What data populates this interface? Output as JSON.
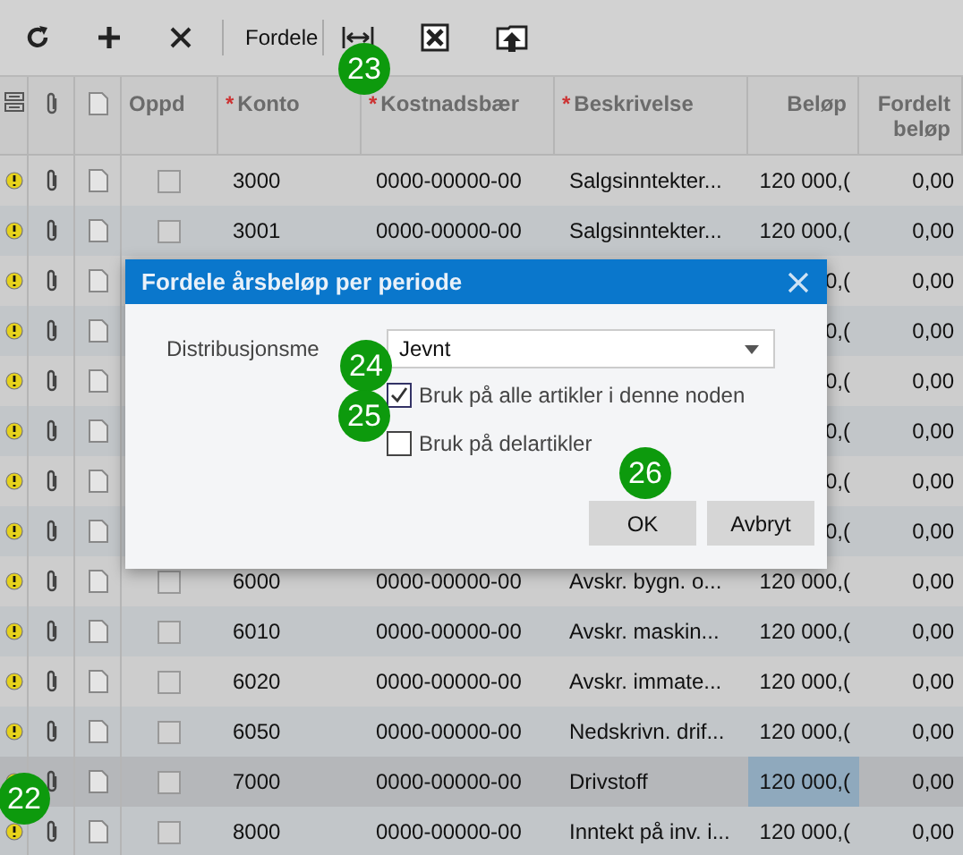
{
  "toolbar": {
    "distribute_button": "Fordele"
  },
  "table": {
    "columns": [
      {
        "label": "Oppd"
      },
      {
        "label": "Konto",
        "mark": "*"
      },
      {
        "label": "Kostnadsbær",
        "mark": "*"
      },
      {
        "label": "Beskrivelse",
        "mark": "*"
      },
      {
        "label": "Beløp"
      },
      {
        "label": "Fordelt beløp"
      }
    ],
    "rows": [
      {
        "konto": "3000",
        "kostnadsbaerer": "0000-00000-00",
        "beskrivelse": "Salgsinntekter...",
        "belop": "120 000,(",
        "fordelt": "0,00",
        "checked": false,
        "selected": false
      },
      {
        "konto": "3001",
        "kostnadsbaerer": "0000-00000-00",
        "beskrivelse": "Salgsinntekter...",
        "belop": "120 000,(",
        "fordelt": "0,00",
        "checked": false,
        "selected": false
      },
      {
        "belop": "0,(",
        "fordelt": "0,00",
        "selected": false
      },
      {
        "belop": "0,(",
        "fordelt": "0,00",
        "selected": false
      },
      {
        "belop": "0,(",
        "fordelt": "0,00",
        "selected": false
      },
      {
        "belop": "0,(",
        "fordelt": "0,00",
        "selected": false
      },
      {
        "belop": "0,(",
        "fordelt": "0,00",
        "selected": false
      },
      {
        "belop": "0,(",
        "fordelt": "0,00",
        "selected": false
      },
      {
        "konto": "6000",
        "kostnadsbaerer": "0000-00000-00",
        "beskrivelse": "Avskr. bygn. o...",
        "belop": "120 000,(",
        "fordelt": "0,00",
        "checked": false,
        "selected": false
      },
      {
        "konto": "6010",
        "kostnadsbaerer": "0000-00000-00",
        "beskrivelse": "Avskr. maskin...",
        "belop": "120 000,(",
        "fordelt": "0,00",
        "checked": false,
        "selected": false
      },
      {
        "konto": "6020",
        "kostnadsbaerer": "0000-00000-00",
        "beskrivelse": "Avskr. immate...",
        "belop": "120 000,(",
        "fordelt": "0,00",
        "checked": false,
        "selected": false
      },
      {
        "konto": "6050",
        "kostnadsbaerer": "0000-00000-00",
        "beskrivelse": "Nedskrivn. drif...",
        "belop": "120 000,(",
        "fordelt": "0,00",
        "checked": false,
        "selected": false
      },
      {
        "konto": "7000",
        "kostnadsbaerer": "0000-00000-00",
        "beskrivelse": "Drivstoff",
        "belop": "120 000,(",
        "fordelt": "0,00",
        "checked": false,
        "selected": true
      },
      {
        "konto": "8000",
        "kostnadsbaerer": "0000-00000-00",
        "beskrivelse": "Inntekt på inv. i...",
        "belop": "120 000,(",
        "fordelt": "0,00",
        "checked": false,
        "selected": false
      }
    ]
  },
  "dialog": {
    "title": "Fordele årsbeløp per periode",
    "method_label": "Distribusjonsme",
    "method_value": "Jevnt",
    "options": [
      {
        "label": "Bruk på alle artikler i denne noden",
        "checked": true
      },
      {
        "label": "Bruk på delartikler",
        "checked": false
      }
    ],
    "buttons": [
      "OK",
      "Avbryt"
    ]
  },
  "callouts": [
    "23",
    "24",
    "25",
    "26",
    "22"
  ]
}
